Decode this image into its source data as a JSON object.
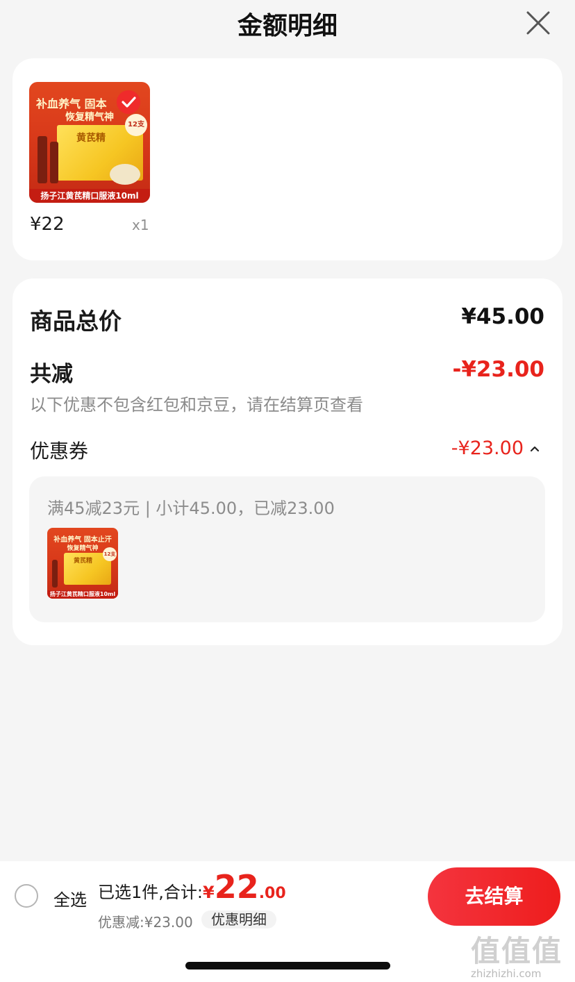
{
  "header": {
    "title": "金额明细"
  },
  "product": {
    "image_line1": "补血养气 固本",
    "image_line2": "恢复精气神",
    "image_box_label": "黄芪精",
    "image_badge": "12支",
    "image_band": "扬子江黄芪精口服液10ml",
    "price": "¥22",
    "qty": "x1"
  },
  "summary": {
    "total_label": "商品总价",
    "total_value": "¥45.00",
    "reduce_label": "共减",
    "reduce_value": "-¥23.00",
    "reduce_note": "以下优惠不包含红包和京豆，请在结算页查看",
    "coupon_label": "优惠券",
    "coupon_value": "-¥23.00",
    "coupon_detail": "满45减23元 | 小计45.00，已减23.00",
    "coupon_thumb_line1": "补血养气 固本止汗",
    "coupon_thumb_line2": "恢复精气神",
    "coupon_thumb_box": "黄芪精",
    "coupon_thumb_badge": "12支",
    "coupon_thumb_band": "扬子江黄芪精口服液10ml"
  },
  "bottom": {
    "select_all": "全选",
    "selected_text": "已选1件,合计:",
    "currency": "¥",
    "amount_int": "22",
    "amount_dec": ".00",
    "discount_text": "优惠减:¥23.00",
    "detail_pill": "优惠明细",
    "checkout": "去结算"
  },
  "watermark": {
    "big": "值值值",
    "small": "zhizhizhi.com"
  },
  "colors": {
    "accent_red": "#e8231c",
    "checkout_red": "#f0262b",
    "background": "#f5f5f5"
  }
}
